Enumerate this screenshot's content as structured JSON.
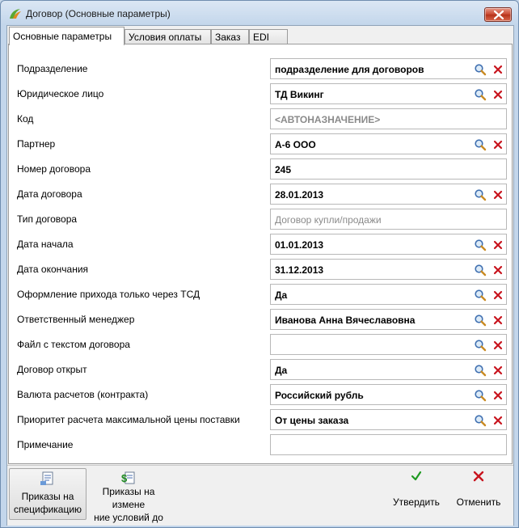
{
  "window": {
    "title": "Договор (Основные параметры)"
  },
  "tabs": [
    {
      "label": "Основные параметры",
      "active": true
    },
    {
      "label": "Условия оплаты",
      "active": false
    },
    {
      "label": "Заказ",
      "active": false
    },
    {
      "label": "EDI",
      "active": false
    }
  ],
  "fields": [
    {
      "label": "Подразделение",
      "value": "подразделение для договоров",
      "style": "bold",
      "buttons": true
    },
    {
      "label": "Юридическое лицо",
      "value": "ТД Викинг",
      "style": "bold",
      "buttons": true
    },
    {
      "label": "Код",
      "value": "<АВТОНАЗНАЧЕНИЕ>",
      "style": "muted",
      "buttons": false
    },
    {
      "label": "Партнер",
      "value": "А-6 ООО",
      "style": "bold",
      "buttons": true
    },
    {
      "label": "Номер договора",
      "value": "245",
      "style": "bold",
      "buttons": false
    },
    {
      "label": "Дата договора",
      "value": "28.01.2013",
      "style": "bold",
      "buttons": true
    },
    {
      "label": "Тип договора",
      "value": "",
      "placeholder": "Договор купли/продажи",
      "style": "placeholder",
      "buttons": false
    },
    {
      "label": "Дата начала",
      "value": "01.01.2013",
      "style": "bold",
      "buttons": true
    },
    {
      "label": "Дата окончания",
      "value": "31.12.2013",
      "style": "bold",
      "buttons": true
    },
    {
      "label": "Оформление прихода только через ТСД",
      "value": "Да",
      "style": "bold",
      "buttons": true
    },
    {
      "label": "Ответственный менеджер",
      "value": "Иванова Анна Вячеславовна",
      "style": "bold",
      "buttons": true
    },
    {
      "label": "Файл с текстом договора",
      "value": "",
      "style": "bold",
      "buttons": true
    },
    {
      "label": "Договор открыт",
      "value": "Да",
      "style": "bold",
      "buttons": true
    },
    {
      "label": "Валюта расчетов (контракта)",
      "value": "Российский рубль",
      "style": "bold",
      "buttons": true
    },
    {
      "label": "Приоритет расчета максимальной цены поставки",
      "value": "От цены заказа",
      "style": "bold",
      "buttons": true
    },
    {
      "label": "Примечание",
      "value": "",
      "style": "bold",
      "buttons": false
    }
  ],
  "toolbar": {
    "spec_orders_line1": "Приказы на",
    "spec_orders_line2": "спецификацию",
    "cond_orders_line1": "Приказы на",
    "cond_orders_line2": "измене",
    "cond_orders_line3": "ние условий до",
    "approve_label": "Утвердить",
    "cancel_label": "Отменить"
  },
  "icons": {
    "search": "magnifier-icon",
    "clear": "red-x-icon",
    "approve": "green-check-icon",
    "cancel": "red-x-icon"
  },
  "colors": {
    "clear_x": "#c8141e",
    "approve_check": "#1f9a22",
    "titlebar_close": "#c8452d"
  }
}
